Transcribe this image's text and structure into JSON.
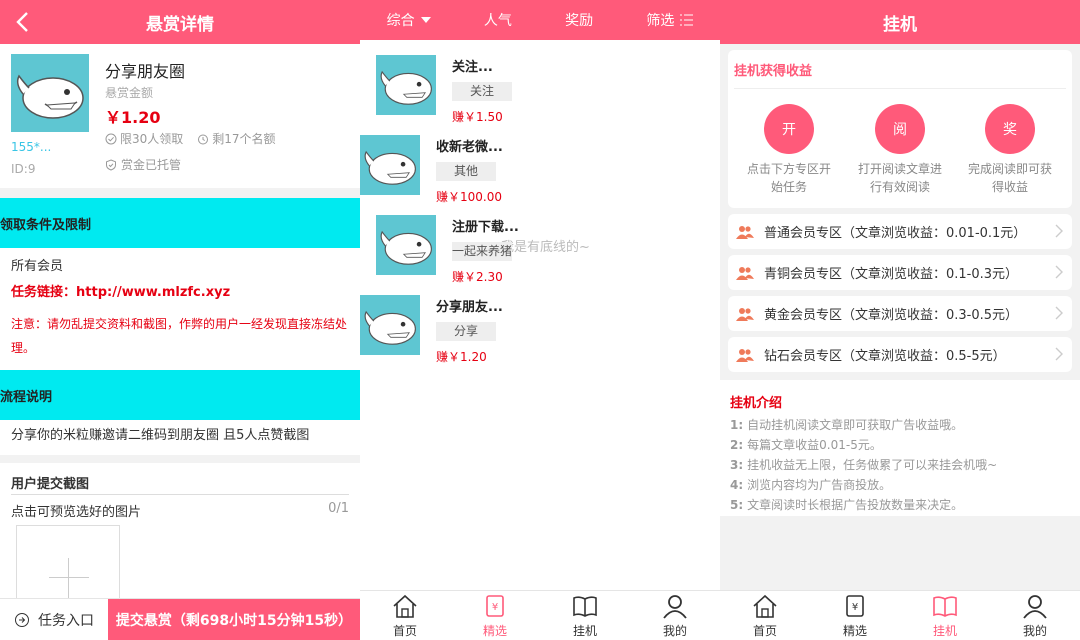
{
  "detail": {
    "header_title": "悬赏详情",
    "task_title": "分享朋友圈",
    "price_label": "悬赏金额",
    "price": "￥1.20",
    "limit": "限30人领取",
    "remaining": "剩17个名额",
    "escrow": "赏金已托管",
    "user": "155*...",
    "task_id": "ID:9",
    "conditions_heading": "领取条件及限制",
    "members": "所有会员",
    "link_label": "任务链接：",
    "link_url": "http://www.mlzfc.xyz",
    "note": "注意：请勿乱提交资料和截图，作弊的用户一经发现直接冻结处理。",
    "flow_heading": "流程说明",
    "flow_text": "分享你的米粒赚邀请二维码到朋友圈 且5人点赞截图",
    "submit_title": "用户提交截图",
    "submit_hint": "点击可预览选好的图片",
    "submit_count": "0/1",
    "entry_label": "任务入口",
    "submit_button": "提交悬赏（剩698小时15分钟15秒）"
  },
  "list": {
    "filters": [
      "综合",
      "人气",
      "奖励",
      "筛选"
    ],
    "items": [
      {
        "title": "关注...",
        "tag": "关注",
        "price": "赚￥1.50"
      },
      {
        "title": "收新老微...",
        "tag": "其他",
        "price": "赚￥100.00"
      },
      {
        "title": "注册下载...",
        "tag": "一起来养猪",
        "price": "赚￥2.30"
      },
      {
        "title": "分享朋友...",
        "tag": "分享",
        "price": "赚￥1.20"
      }
    ],
    "no_more": "~我是有底线的~"
  },
  "tabs": [
    "首页",
    "精选",
    "挂机",
    "我的"
  ],
  "hang": {
    "header_title": "挂机",
    "earn_title": "挂机获得收益",
    "steps": [
      {
        "icon": "开",
        "text1": "点击下方专区开",
        "text2": "始任务"
      },
      {
        "icon": "阅",
        "text1": "打开阅读文章进",
        "text2": "行有效阅读"
      },
      {
        "icon": "奖",
        "text1": "完成阅读即可获",
        "text2": "得收益"
      }
    ],
    "zones": [
      "普通会员专区（文章浏览收益：0.01-0.1元）",
      "青铜会员专区（文章浏览收益：0.1-0.3元）",
      "黄金会员专区（文章浏览收益：0.3-0.5元）",
      "钻石会员专区（文章浏览收益：0.5-5元）"
    ],
    "intro_title": "挂机介绍",
    "intro": [
      {
        "n": "1:",
        "t": "自动挂机阅读文章即可获取广告收益哦。"
      },
      {
        "n": "2:",
        "t": "每篇文章收益0.01-5元。"
      },
      {
        "n": "3:",
        "t": "挂机收益无上限，任务做累了可以来挂会机哦~"
      },
      {
        "n": "4:",
        "t": "浏览内容均为广告商投放。"
      },
      {
        "n": "5:",
        "t": "文章阅读时长根据广告投放数量来决定。"
      }
    ]
  },
  "colors": {
    "brand": "#ff5a7a",
    "cyan": "#00eaf0",
    "price_red": "#e60012"
  }
}
